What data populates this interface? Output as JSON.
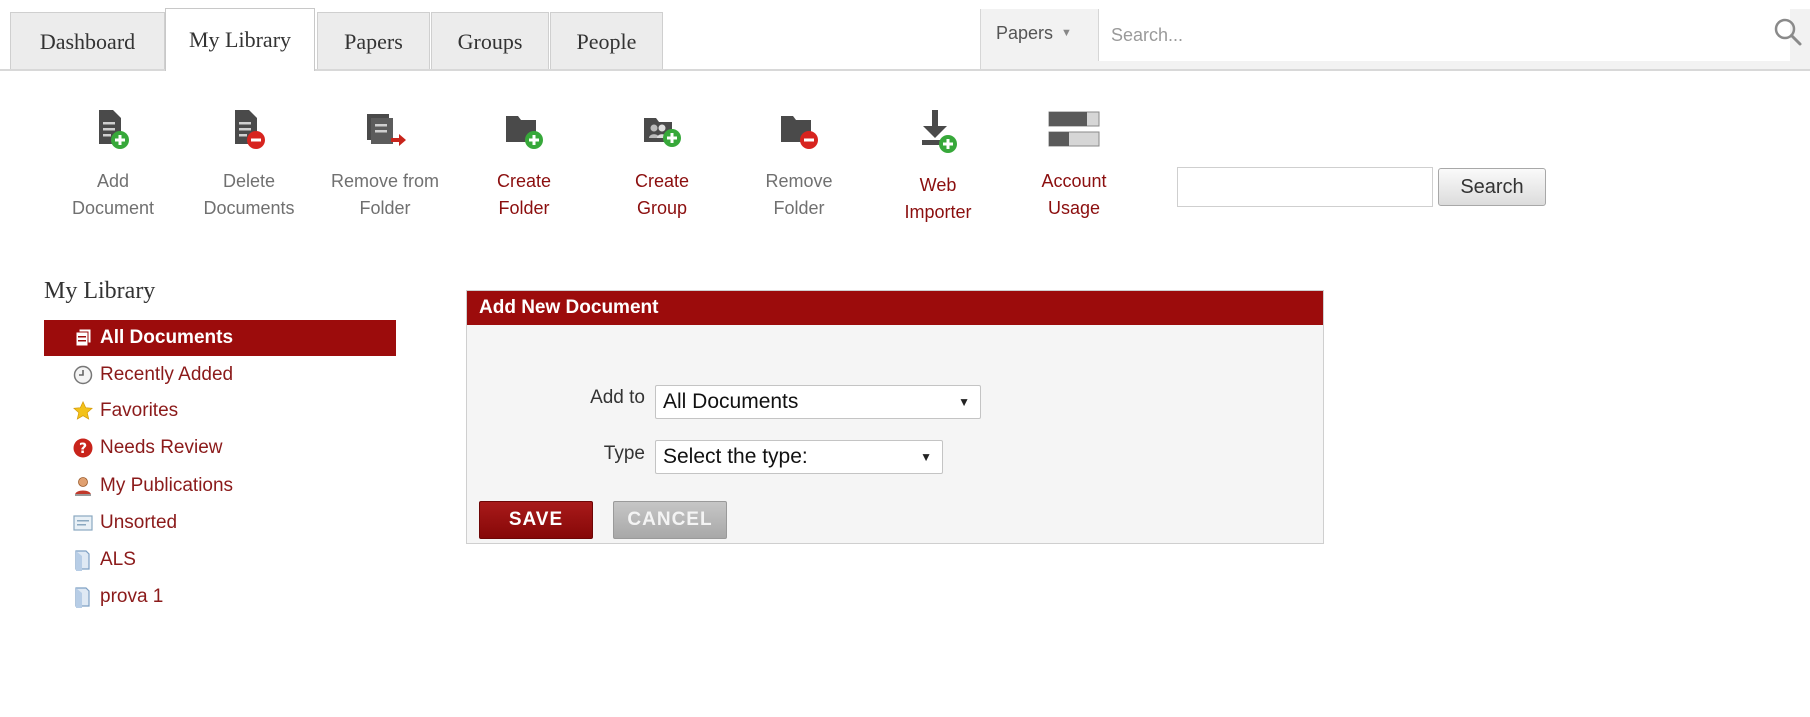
{
  "nav": {
    "tabs": [
      {
        "label": "Dashboard",
        "active": false
      },
      {
        "label": "My Library",
        "active": true
      },
      {
        "label": "Papers",
        "active": false
      },
      {
        "label": "Groups",
        "active": false
      },
      {
        "label": "People",
        "active": false
      }
    ],
    "search_scope": "Papers",
    "search_placeholder": "Search..."
  },
  "toolbar": {
    "items": [
      {
        "label": "Add\nDocument",
        "icon": "add-document-icon",
        "enabled": false
      },
      {
        "label": "Delete\nDocuments",
        "icon": "delete-documents-icon",
        "enabled": false
      },
      {
        "label": "Remove from\nFolder",
        "icon": "remove-from-folder-icon",
        "enabled": false
      },
      {
        "label": "Create\nFolder",
        "icon": "create-folder-icon",
        "enabled": true
      },
      {
        "label": "Create\nGroup",
        "icon": "create-group-icon",
        "enabled": true
      },
      {
        "label": "Remove\nFolder",
        "icon": "remove-folder-icon",
        "enabled": false
      },
      {
        "label": "Web\nImporter",
        "icon": "web-importer-icon",
        "enabled": true
      },
      {
        "label": "Account\nUsage",
        "icon": "account-usage-icon",
        "enabled": true
      }
    ],
    "search_button": "Search"
  },
  "sidebar": {
    "title": "My Library",
    "items": [
      {
        "label": "All Documents",
        "icon": "documents-stack-icon",
        "active": true
      },
      {
        "label": "Recently Added",
        "icon": "clock-icon",
        "active": false
      },
      {
        "label": "Favorites",
        "icon": "star-icon",
        "active": false
      },
      {
        "label": "Needs Review",
        "icon": "question-icon",
        "active": false
      },
      {
        "label": "My Publications",
        "icon": "person-icon",
        "active": false
      },
      {
        "label": "Unsorted",
        "icon": "inbox-icon",
        "active": false
      },
      {
        "label": "ALS",
        "icon": "folder-icon",
        "active": false
      },
      {
        "label": "prova 1",
        "icon": "folder-icon",
        "active": false
      }
    ]
  },
  "panel": {
    "title": "Add New Document",
    "add_to_label": "Add to",
    "add_to_value": "All Documents",
    "type_label": "Type",
    "type_value": "Select the type:",
    "save_label": "SAVE",
    "cancel_label": "CANCEL"
  },
  "colors": {
    "accent": "#9c0c0c",
    "link": "#8b1a1a",
    "muted": "#666666"
  }
}
